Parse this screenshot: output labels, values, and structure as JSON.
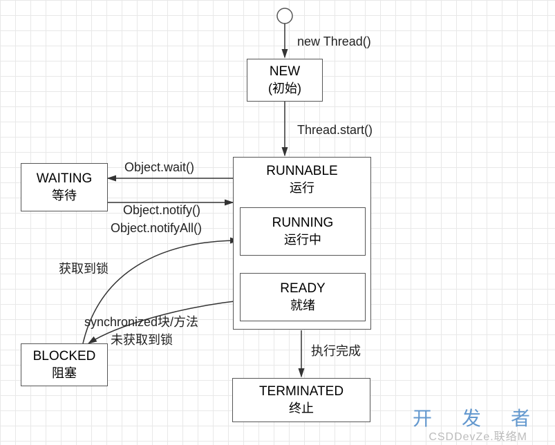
{
  "nodes": {
    "new": {
      "title": "NEW",
      "sub": "(初始)"
    },
    "runnable": {
      "title": "RUNNABLE",
      "sub": "运行"
    },
    "running": {
      "title": "RUNNING",
      "sub": "运行中"
    },
    "ready": {
      "title": "READY",
      "sub": "就绪"
    },
    "waiting": {
      "title": "WAITING",
      "sub": "等待"
    },
    "blocked": {
      "title": "BLOCKED",
      "sub": "阻塞"
    },
    "terminated": {
      "title": "TERMINATED",
      "sub": "终止"
    }
  },
  "edges": {
    "new_thread": "new Thread()",
    "thread_start": "Thread.start()",
    "object_wait": "Object.wait()",
    "object_notify": "Object.notify()",
    "notify_all": "Object.notifyAll()",
    "got_lock": "获取到锁",
    "sync_block": "synchronized块/方法",
    "not_got_lock": "未获取到锁",
    "exec_done": "执行完成"
  },
  "watermark": {
    "brand": "开 发 者",
    "csdn": "CSDDevZe.联络M"
  },
  "chart_data": {
    "type": "state-diagram",
    "title": "Java Thread State Transitions",
    "states": [
      "INITIAL",
      "NEW",
      "RUNNABLE",
      "RUNNING",
      "READY",
      "WAITING",
      "BLOCKED",
      "TERMINATED"
    ],
    "initial_state": "INITIAL",
    "transitions": [
      {
        "from": "INITIAL",
        "to": "NEW",
        "label": "new Thread()"
      },
      {
        "from": "NEW",
        "to": "RUNNABLE",
        "label": "Thread.start()"
      },
      {
        "from": "RUNNABLE",
        "to": "WAITING",
        "label": "Object.wait()"
      },
      {
        "from": "WAITING",
        "to": "RUNNABLE",
        "label": "Object.notify()"
      },
      {
        "from": "WAITING",
        "to": "RUNNABLE",
        "label": "Object.notifyAll()"
      },
      {
        "from": "BLOCKED",
        "to": "RUNNING",
        "label": "获取到锁"
      },
      {
        "from": "READY",
        "to": "BLOCKED",
        "label": "synchronized块/方法 未获取到锁"
      },
      {
        "from": "RUNNABLE",
        "to": "TERMINATED",
        "label": "执行完成"
      }
    ],
    "composite": {
      "RUNNABLE": [
        "RUNNING",
        "READY"
      ]
    }
  }
}
